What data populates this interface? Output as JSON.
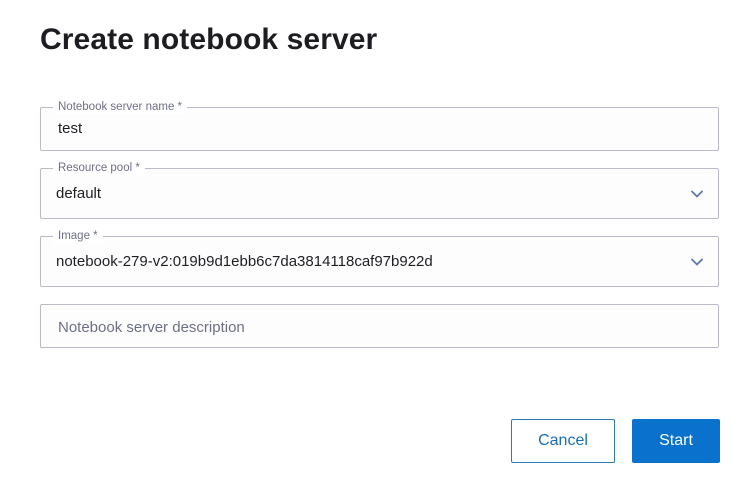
{
  "dialog": {
    "title": "Create notebook server"
  },
  "form": {
    "name": {
      "label": "Notebook server name *",
      "value": "test"
    },
    "resource_pool": {
      "label": "Resource pool *",
      "value": "default",
      "icon": "chevron-down-icon"
    },
    "image": {
      "label": "Image *",
      "value": "notebook-279-v2:019b9d1ebb6c7da3814118caf97b922d",
      "icon": "chevron-down-icon"
    },
    "description": {
      "placeholder": "Notebook server description"
    }
  },
  "actions": {
    "cancel_label": "Cancel",
    "start_label": "Start"
  },
  "colors": {
    "primary": "#0a72cc",
    "border": "#b9bcc6",
    "label": "#6f6f87",
    "chevron": "#5c78a8"
  }
}
